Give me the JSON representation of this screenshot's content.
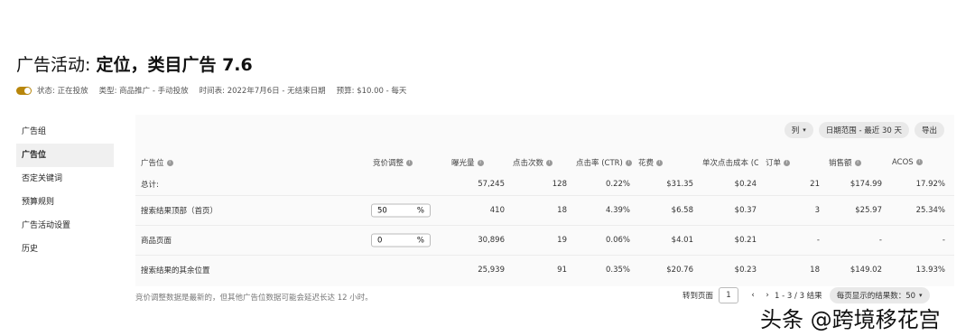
{
  "title": {
    "prefix": "广告活动: ",
    "name": "定位，类目广告 7.6"
  },
  "meta": {
    "status": "状态: 正在投放",
    "type": "类型: 商品推广 - 手动投放",
    "schedule": "时间表: 2022年7月6日 - 无结束日期",
    "budget": "预算: $10.00 - 每天"
  },
  "sidebar": {
    "items": [
      {
        "label": "广告组"
      },
      {
        "label": "广告位"
      },
      {
        "label": "否定关键词"
      },
      {
        "label": "预算规则"
      },
      {
        "label": "广告活动设置"
      },
      {
        "label": "历史"
      }
    ]
  },
  "toolbar": {
    "columns": "列",
    "date_range": "日期范围 - 最近 30 天",
    "export": "导出"
  },
  "table": {
    "headers": {
      "placement": "广告位",
      "bid_adjust": "竞价调整",
      "impressions": "曝光量",
      "clicks": "点击次数",
      "ctr": "点击率 (CTR)",
      "spend": "花费",
      "cpc": "单次点击成本 (CPC)",
      "orders": "订单",
      "sales": "销售额",
      "acos": "ACOS"
    },
    "total": {
      "label": "总计:",
      "impressions": "57,245",
      "clicks": "128",
      "ctr": "0.22%",
      "spend": "$31.35",
      "cpc": "$0.24",
      "orders": "21",
      "sales": "$174.99",
      "acos": "17.92%"
    },
    "rows": [
      {
        "placement": "搜索结果顶部（首页）",
        "bid": "50",
        "unit": "%",
        "impressions": "410",
        "clicks": "18",
        "ctr": "4.39%",
        "spend": "$6.58",
        "cpc": "$0.37",
        "orders": "3",
        "sales": "$25.97",
        "acos": "25.34%"
      },
      {
        "placement": "商品页面",
        "bid": "0",
        "unit": "%",
        "impressions": "30,896",
        "clicks": "19",
        "ctr": "0.06%",
        "spend": "$4.01",
        "cpc": "$0.21",
        "orders": "-",
        "sales": "-",
        "acos": "-"
      },
      {
        "placement": "搜索结果的其余位置",
        "bid": "",
        "unit": "",
        "impressions": "25,939",
        "clicks": "91",
        "ctr": "0.35%",
        "spend": "$20.76",
        "cpc": "$0.23",
        "orders": "18",
        "sales": "$149.02",
        "acos": "13.93%"
      }
    ]
  },
  "footnote": "竞价调整数据是最新的，但其他广告位数据可能会延迟长达 12 小时。",
  "pager": {
    "go_to": "转到页面",
    "page": "1",
    "range": "1 - 3 / 3 结果",
    "per_page": "每页显示的结果数：50"
  },
  "watermark": "头条 @跨境移花宫"
}
